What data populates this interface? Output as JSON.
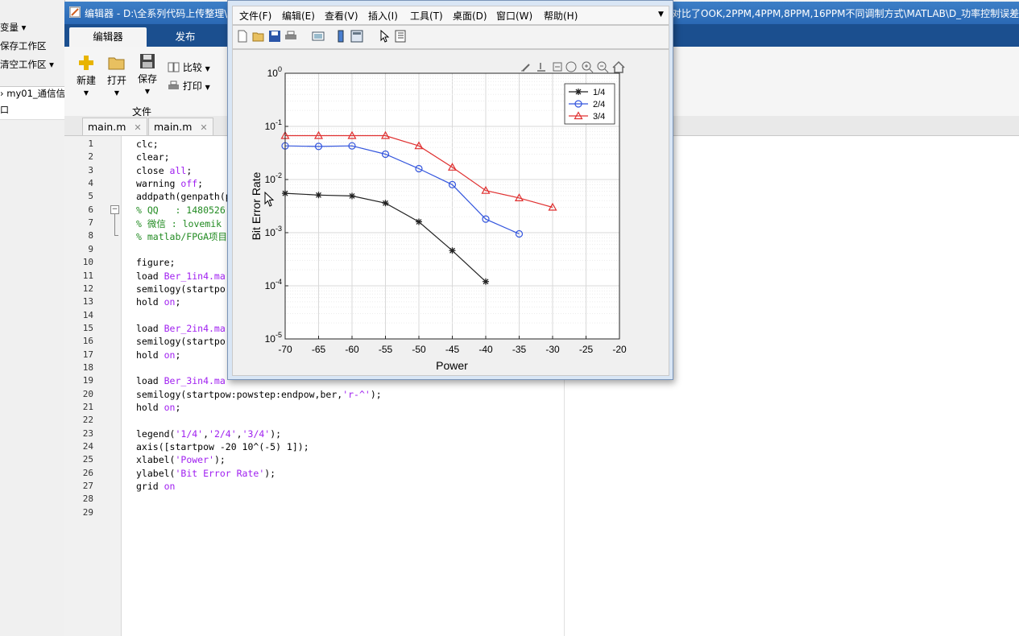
{
  "left_panel": {
    "items": [
      "变量 ▾",
      "保存工作区",
      "清空工作区 ▾"
    ],
    "path": "› my01_通信信",
    "sub": "口"
  },
  "editor": {
    "title": "编辑器 - D:\\全系列代码上传整理\\",
    "title_right": "对比了OOK,2PPM,4PPM,8PPM,16PPM不同调制方式\\MATLAB\\D_功率控制误差在",
    "tabs": [
      "编辑器",
      "发布"
    ],
    "ribbon": {
      "new": "新建",
      "open": "打开",
      "save": "保存",
      "compare": "比较",
      "print": "打印",
      "group_label": "文件"
    },
    "file_tabs": [
      "main.m",
      "main.m"
    ],
    "code_lines": [
      {
        "n": "1",
        "parts": [
          {
            "t": "clc;",
            "c": ""
          }
        ]
      },
      {
        "n": "2",
        "parts": [
          {
            "t": "clear;",
            "c": ""
          }
        ]
      },
      {
        "n": "3",
        "parts": [
          {
            "t": "close ",
            "c": ""
          },
          {
            "t": "all",
            "c": "kw"
          },
          {
            "t": ";",
            "c": ""
          }
        ]
      },
      {
        "n": "4",
        "parts": [
          {
            "t": "warning ",
            "c": ""
          },
          {
            "t": "off",
            "c": "kw"
          },
          {
            "t": ";",
            "c": ""
          }
        ]
      },
      {
        "n": "5",
        "parts": [
          {
            "t": "addpath(genpath(p",
            "c": ""
          }
        ]
      },
      {
        "n": "6",
        "parts": [
          {
            "t": "% QQ   : 1480526",
            "c": "cm"
          }
        ]
      },
      {
        "n": "7",
        "parts": [
          {
            "t": "% 微信 : lovemik",
            "c": "cm"
          }
        ]
      },
      {
        "n": "8",
        "parts": [
          {
            "t": "% matlab/FPGA项目",
            "c": "cm"
          }
        ]
      },
      {
        "n": "9",
        "parts": []
      },
      {
        "n": "10",
        "parts": [
          {
            "t": "figure;",
            "c": ""
          }
        ]
      },
      {
        "n": "11",
        "parts": [
          {
            "t": "load ",
            "c": ""
          },
          {
            "t": "Ber_1in4.ma",
            "c": "st"
          }
        ]
      },
      {
        "n": "12",
        "parts": [
          {
            "t": "semilogy(startpo",
            "c": ""
          }
        ]
      },
      {
        "n": "13",
        "parts": [
          {
            "t": "hold ",
            "c": ""
          },
          {
            "t": "on",
            "c": "kw"
          },
          {
            "t": ";",
            "c": ""
          }
        ]
      },
      {
        "n": "14",
        "parts": []
      },
      {
        "n": "15",
        "parts": [
          {
            "t": "load ",
            "c": ""
          },
          {
            "t": "Ber_2in4.ma",
            "c": "st"
          }
        ]
      },
      {
        "n": "16",
        "parts": [
          {
            "t": "semilogy(startpo",
            "c": ""
          }
        ]
      },
      {
        "n": "17",
        "parts": [
          {
            "t": "hold ",
            "c": ""
          },
          {
            "t": "on",
            "c": "kw"
          },
          {
            "t": ";",
            "c": ""
          }
        ]
      },
      {
        "n": "18",
        "parts": []
      },
      {
        "n": "19",
        "parts": [
          {
            "t": "load ",
            "c": ""
          },
          {
            "t": "Ber_3in4.ma",
            "c": "st"
          }
        ]
      },
      {
        "n": "20",
        "parts": [
          {
            "t": "semilogy(startpow:powstep:endpow,ber,",
            "c": ""
          },
          {
            "t": "'r-^'",
            "c": "st"
          },
          {
            "t": ");",
            "c": ""
          }
        ]
      },
      {
        "n": "21",
        "parts": [
          {
            "t": "hold ",
            "c": ""
          },
          {
            "t": "on",
            "c": "kw"
          },
          {
            "t": ";",
            "c": ""
          }
        ]
      },
      {
        "n": "22",
        "parts": []
      },
      {
        "n": "23",
        "parts": [
          {
            "t": "legend(",
            "c": ""
          },
          {
            "t": "'1/4'",
            "c": "st"
          },
          {
            "t": ",",
            "c": ""
          },
          {
            "t": "'2/4'",
            "c": "st"
          },
          {
            "t": ",",
            "c": ""
          },
          {
            "t": "'3/4'",
            "c": "st"
          },
          {
            "t": ");",
            "c": ""
          }
        ]
      },
      {
        "n": "24",
        "parts": [
          {
            "t": "axis([startpow -20 10^(-5) 1]);",
            "c": ""
          }
        ]
      },
      {
        "n": "25",
        "parts": [
          {
            "t": "xlabel(",
            "c": ""
          },
          {
            "t": "'Power'",
            "c": "st"
          },
          {
            "t": ");",
            "c": ""
          }
        ]
      },
      {
        "n": "26",
        "parts": [
          {
            "t": "ylabel(",
            "c": ""
          },
          {
            "t": "'Bit Error Rate'",
            "c": "st"
          },
          {
            "t": ");",
            "c": ""
          }
        ]
      },
      {
        "n": "27",
        "parts": [
          {
            "t": "grid ",
            "c": ""
          },
          {
            "t": "on",
            "c": "kw"
          }
        ]
      },
      {
        "n": "28",
        "parts": []
      },
      {
        "n": "29",
        "parts": []
      }
    ]
  },
  "figure": {
    "menu": [
      "文件(F)",
      "编辑(E)",
      "查看(V)",
      "插入(I)",
      "工具(T)",
      "桌面(D)",
      "窗口(W)",
      "帮助(H)"
    ]
  },
  "colors": {
    "s1": "#222222",
    "s2": "#3355dd",
    "s3": "#e03030",
    "grid": "#d9d9d9"
  },
  "chart_data": {
    "type": "line",
    "xlabel": "Power",
    "ylabel": "Bit Error Rate",
    "xlim": [
      -70,
      -20
    ],
    "ylim": [
      1e-05,
      1
    ],
    "yscale": "log",
    "grid": true,
    "legend_position": "top-right",
    "xticks": [
      -70,
      -65,
      -60,
      -55,
      -50,
      -45,
      -40,
      -35,
      -30,
      -25,
      -20
    ],
    "yticks": [
      1e-05,
      0.0001,
      0.001,
      0.01,
      0.1,
      1
    ],
    "series": [
      {
        "name": "1/4",
        "marker": "star",
        "color": "#222222",
        "x": [
          -70,
          -65,
          -60,
          -55,
          -50,
          -45,
          -40
        ],
        "y": [
          0.0055,
          0.0051,
          0.0049,
          0.0036,
          0.0016,
          0.00046,
          0.00012
        ]
      },
      {
        "name": "2/4",
        "marker": "circle",
        "color": "#3355dd",
        "x": [
          -70,
          -65,
          -60,
          -55,
          -50,
          -45,
          -40,
          -35
        ],
        "y": [
          0.043,
          0.042,
          0.043,
          0.03,
          0.016,
          0.008,
          0.0018,
          0.00095
        ]
      },
      {
        "name": "3/4",
        "marker": "triangle",
        "color": "#e03030",
        "x": [
          -70,
          -65,
          -60,
          -55,
          -50,
          -45,
          -40,
          -35,
          -30
        ],
        "y": [
          0.067,
          0.067,
          0.067,
          0.067,
          0.043,
          0.017,
          0.0062,
          0.0045,
          0.003
        ]
      }
    ]
  }
}
